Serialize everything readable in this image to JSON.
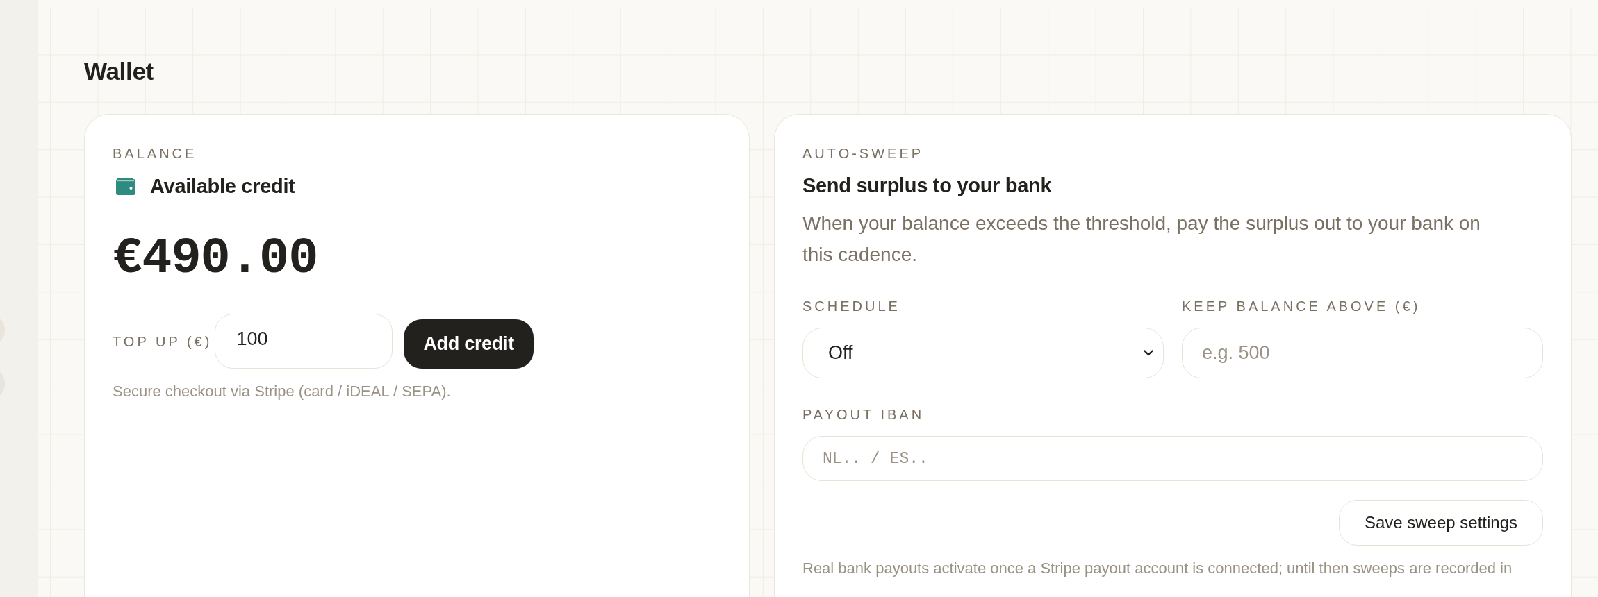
{
  "page": {
    "title": "Wallet"
  },
  "balance_card": {
    "label": "BALANCE",
    "title": "Available credit",
    "amount": "€490.00",
    "top_up": {
      "label": "TOP UP (€)",
      "value": "100",
      "button": "Add credit"
    },
    "note": "Secure checkout via Stripe (card / iDEAL / SEPA)."
  },
  "sweep_card": {
    "label": "AUTO-SWEEP",
    "title": "Send surplus to your bank",
    "description": "When your balance exceeds the threshold, pay the surplus out to your bank on this cadence.",
    "rows": [
      [
        {
          "kind": "select",
          "label": "SCHEDULE",
          "value": "Off"
        },
        {
          "kind": "input",
          "label": "KEEP BALANCE ABOVE (€)",
          "placeholder": "e.g. 500"
        }
      ],
      [
        {
          "kind": "mono_input",
          "label": "PAYOUT IBAN",
          "placeholder": "NL.. / ES.."
        }
      ]
    ],
    "button": "Save sweep settings",
    "note": "Real bank payouts activate once a Stripe payout account is connected; until then sweeps are recorded in"
  }
}
